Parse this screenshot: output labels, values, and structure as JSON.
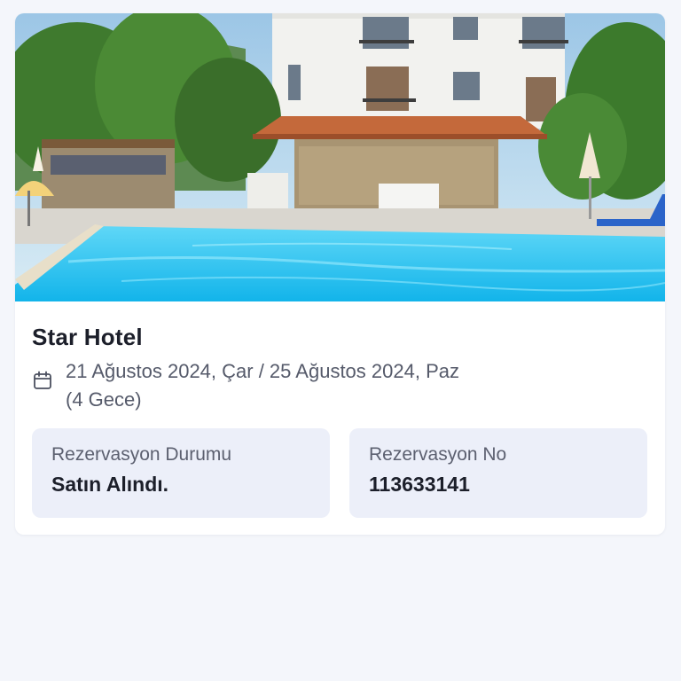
{
  "hotel": {
    "name": "Star Hotel",
    "dates_line1": "21 Ağustos 2024, Çar / 25 Ağustos 2024, Paz",
    "dates_line2": "(4 Gece)"
  },
  "status": {
    "label": "Rezervasyon Durumu",
    "value": "Satın Alındı."
  },
  "reservation": {
    "label": "Rezervasyon No",
    "value": "113633141"
  },
  "icons": {
    "calendar": "calendar-icon"
  },
  "colors": {
    "background": "#f4f6fb",
    "card": "#ffffff",
    "info_box": "#eceff9",
    "pool": "#2fc6ee"
  }
}
